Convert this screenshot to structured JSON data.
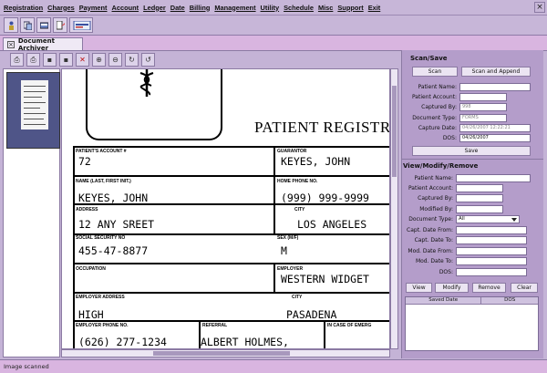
{
  "menu": [
    "Registration",
    "Charges",
    "Payment",
    "Account",
    "Ledger",
    "Date",
    "Billing",
    "Management",
    "Utility",
    "Schedule",
    "Misc",
    "Support",
    "Exit"
  ],
  "window": {
    "close_glyph": "×"
  },
  "toolbar_icons": [
    "patient-icon",
    "charges-icon",
    "batch-icon",
    "document-icon",
    "print-icon"
  ],
  "tab": {
    "label": "Document Archiver",
    "close_glyph": "×"
  },
  "viewer_tools": [
    {
      "name": "scan-icon",
      "glyph": "⎙"
    },
    {
      "name": "print-icon",
      "glyph": "⎙"
    },
    {
      "name": "save-icon",
      "glyph": "▪"
    },
    {
      "name": "save-as-icon",
      "glyph": "▪"
    },
    {
      "name": "delete-icon",
      "glyph": "✕"
    },
    {
      "name": "zoom-in-icon",
      "glyph": "⊕"
    },
    {
      "name": "zoom-out-icon",
      "glyph": "⊖"
    },
    {
      "name": "rotate-right-icon",
      "glyph": "↻"
    },
    {
      "name": "rotate-left-icon",
      "glyph": "↺"
    }
  ],
  "document": {
    "title": "PATIENT REGISTR",
    "fields": {
      "account_label": "PATIENT'S ACCOUNT #",
      "account_value": "72",
      "guarantor_label": "GUARANTOR",
      "guarantor_value": "KEYES, JOHN",
      "name_label": "NAME (LAST, FIRST INIT.)",
      "name_value": "KEYES, JOHN",
      "home_phone_label": "HOME PHONE NO.",
      "home_phone_value": "(999) 999-9999",
      "address_label": "ADDRESS",
      "address_value": "12 ANY SREET",
      "city_label": "CITY",
      "city_value": "LOS ANGELES",
      "ssn_label": "SOCIAL SECURITY NO",
      "ssn_value": "455-47-8877",
      "sex_label": "SEX (M/F)",
      "sex_value": "M",
      "occupation_label": "OCCUPATION",
      "employer_label": "EMPLOYER",
      "employer_value": "WESTERN WIDGET",
      "employer_address_label": "EMPLOYER ADDRESS",
      "employer_address_value": "HIGH",
      "employer_city_label": "CITY",
      "employer_city_value": "PASADENA",
      "employer_phone_label": "EMPLOYER PHONE NO.",
      "employer_phone_value": "(626) 277-1234",
      "referral_label": "REFERRAL",
      "referral_value": "ALBERT HOLMES,",
      "emergency_label": "IN CASE OF EMERG"
    }
  },
  "scan_save": {
    "title": "Scan/Save",
    "scan_button": "Scan",
    "scan_append_button": "Scan and Append",
    "patient_name_label": "Patient Name:",
    "patient_name_value": "",
    "patient_account_label": "Patient Account:",
    "patient_account_value": "",
    "captured_by_label": "Captured By:",
    "captured_by_value": "998",
    "document_type_label": "Document Type:",
    "document_type_value": "FORMS",
    "capture_date_label": "Capture Date:",
    "capture_date_value": "04/26/2007 12:22:21",
    "dos_label": "DOS:",
    "dos_value": "04/26/2007",
    "save_button": "Save"
  },
  "view_modify": {
    "title": "View/Modify/Remove",
    "patient_name_label": "Patient Name:",
    "patient_account_label": "Patient Account:",
    "captured_by_label": "Captured By:",
    "modified_by_label": "Modified By:",
    "document_type_label": "Document Type:",
    "document_type_value": "All",
    "capt_date_from_label": "Capt. Date From:",
    "capt_date_to_label": "Capt. Date To:",
    "mod_date_from_label": "Mod. Date From:",
    "mod_date_to_label": "Mod. Date To:",
    "dos_label": "DOS:",
    "view_button": "View",
    "modify_button": "Modify",
    "remove_button": "Remove",
    "clear_button": "Clear",
    "columns": [
      "Saved Date",
      "DOS"
    ]
  },
  "status": {
    "text": "Image scanned"
  }
}
